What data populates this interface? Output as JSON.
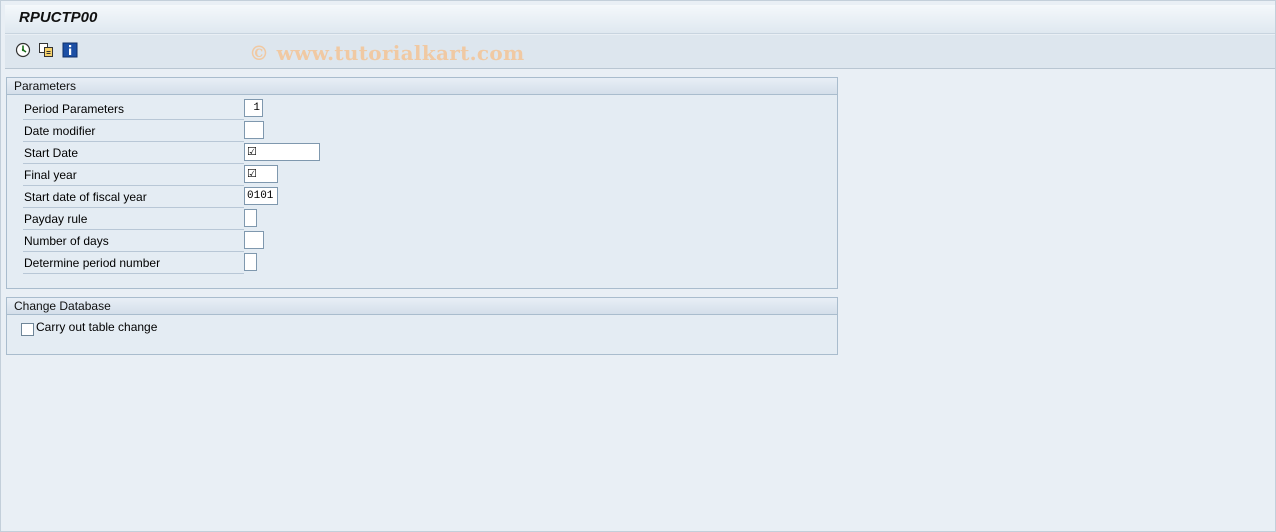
{
  "window": {
    "title": "RPUCTP00"
  },
  "watermark": "© www.tutorialkart.com",
  "toolbar": {
    "items": [
      {
        "icon": "execute-icon"
      },
      {
        "icon": "get-variant-icon"
      },
      {
        "icon": "information-icon"
      }
    ]
  },
  "parameters": {
    "title": "Parameters",
    "rows": [
      {
        "label": "Period Parameters",
        "value": "1"
      },
      {
        "label": "Date modifier",
        "value": ""
      },
      {
        "label": "Start Date",
        "value": "☑"
      },
      {
        "label": "Final year",
        "value": "☑"
      },
      {
        "label": "Start date of fiscal year",
        "value": "0101"
      },
      {
        "label": "Payday rule",
        "value": ""
      },
      {
        "label": "Number of days",
        "value": ""
      },
      {
        "label": "Determine period number",
        "value": ""
      }
    ]
  },
  "change_database": {
    "title": "Change Database",
    "checkbox_label": "Carry out table change",
    "checked": false
  }
}
